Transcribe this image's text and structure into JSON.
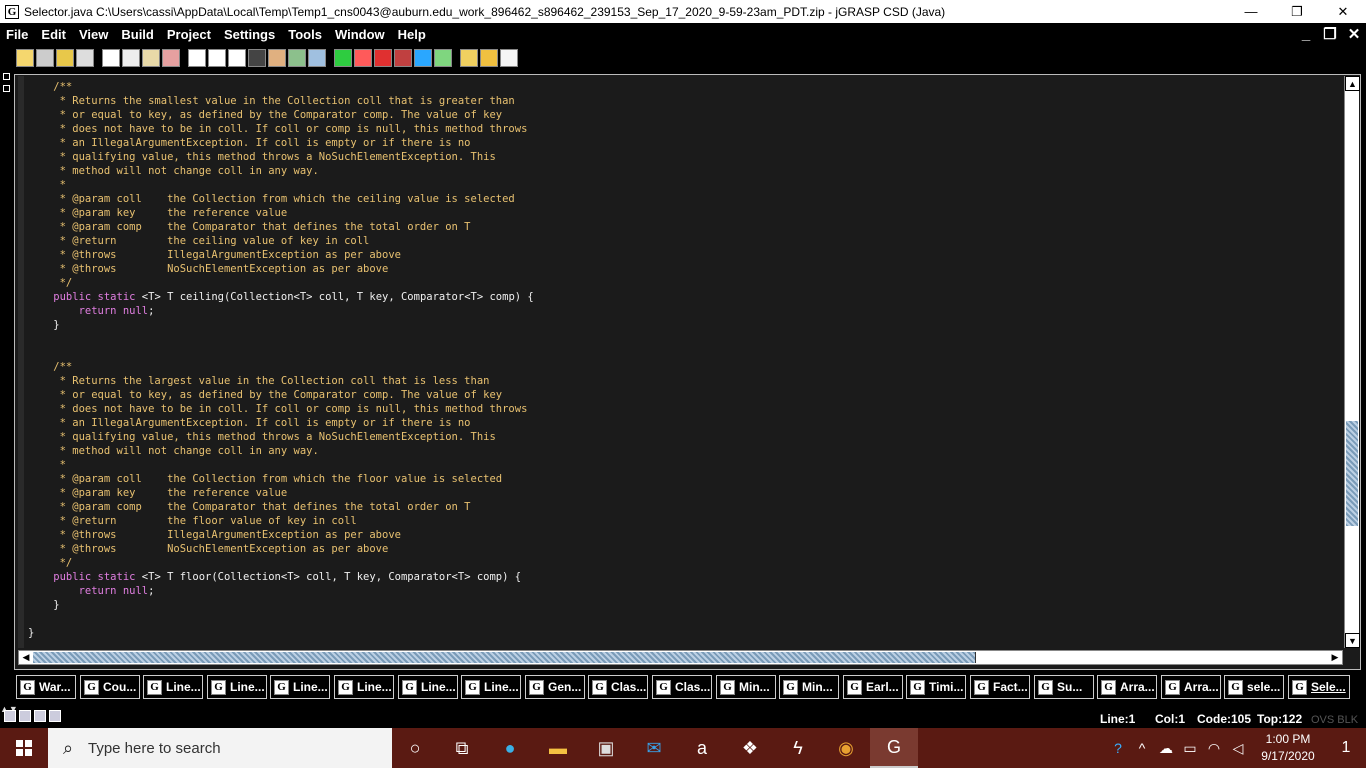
{
  "window": {
    "icon": "G",
    "title": "Selector.java  C:\\Users\\cassi\\AppData\\Local\\Temp\\Temp1_cns0043@auburn.edu_work_896462_s896462_239153_Sep_17_2020_9-59-23am_PDT.zip - jGRASP CSD (Java)",
    "minimize": "—",
    "restore": "❐",
    "close": "✕"
  },
  "menu": [
    "File",
    "Edit",
    "View",
    "Build",
    "Project",
    "Settings",
    "Tools",
    "Window",
    "Help"
  ],
  "mdi": {
    "minimize": "_",
    "restore": "❐",
    "close": "✕"
  },
  "code_lines": [
    [
      [
        "c-comment",
        "    /**"
      ]
    ],
    [
      [
        "c-comment",
        "     * Returns the smallest value in the Collection coll that is greater than"
      ]
    ],
    [
      [
        "c-comment",
        "     * or equal to key, as defined by the Comparator comp. The value of key"
      ]
    ],
    [
      [
        "c-comment",
        "     * does not have to be in coll. If coll or comp is null, this method throws"
      ]
    ],
    [
      [
        "c-comment",
        "     * an IllegalArgumentException. If coll is empty or if there is no"
      ]
    ],
    [
      [
        "c-comment",
        "     * qualifying value, this method throws a NoSuchElementException. This"
      ]
    ],
    [
      [
        "c-comment",
        "     * method will not change coll in any way."
      ]
    ],
    [
      [
        "c-comment",
        "     *"
      ]
    ],
    [
      [
        "c-comment",
        "     * @param coll    the Collection from which the ceiling value is selected"
      ]
    ],
    [
      [
        "c-comment",
        "     * @param key     the reference value"
      ]
    ],
    [
      [
        "c-comment",
        "     * @param comp    the Comparator that defines the total order on T"
      ]
    ],
    [
      [
        "c-comment",
        "     * @return        the ceiling value of key in coll"
      ]
    ],
    [
      [
        "c-comment",
        "     * @throws        IllegalArgumentException as per above"
      ]
    ],
    [
      [
        "c-comment",
        "     * @throws        NoSuchElementException as per above"
      ]
    ],
    [
      [
        "c-comment",
        "     */"
      ]
    ],
    [
      [
        "c-kw",
        "    public static "
      ],
      [
        "c-txt",
        "<T> T ceiling(Collection<T> coll, T key, Comparator<T> comp) {"
      ]
    ],
    [
      [
        "c-kw",
        "        return null"
      ],
      [
        "c-txt",
        ";"
      ]
    ],
    [
      [
        "c-txt",
        "    }"
      ]
    ],
    [
      [
        "c-txt",
        ""
      ]
    ],
    [
      [
        "c-txt",
        ""
      ]
    ],
    [
      [
        "c-comment",
        "    /**"
      ]
    ],
    [
      [
        "c-comment",
        "     * Returns the largest value in the Collection coll that is less than"
      ]
    ],
    [
      [
        "c-comment",
        "     * or equal to key, as defined by the Comparator comp. The value of key"
      ]
    ],
    [
      [
        "c-comment",
        "     * does not have to be in coll. If coll or comp is null, this method throws"
      ]
    ],
    [
      [
        "c-comment",
        "     * an IllegalArgumentException. If coll is empty or if there is no"
      ]
    ],
    [
      [
        "c-comment",
        "     * qualifying value, this method throws a NoSuchElementException. This"
      ]
    ],
    [
      [
        "c-comment",
        "     * method will not change coll in any way."
      ]
    ],
    [
      [
        "c-comment",
        "     *"
      ]
    ],
    [
      [
        "c-comment",
        "     * @param coll    the Collection from which the floor value is selected"
      ]
    ],
    [
      [
        "c-comment",
        "     * @param key     the reference value"
      ]
    ],
    [
      [
        "c-comment",
        "     * @param comp    the Comparator that defines the total order on T"
      ]
    ],
    [
      [
        "c-comment",
        "     * @return        the floor value of key in coll"
      ]
    ],
    [
      [
        "c-comment",
        "     * @throws        IllegalArgumentException as per above"
      ]
    ],
    [
      [
        "c-comment",
        "     * @throws        NoSuchElementException as per above"
      ]
    ],
    [
      [
        "c-comment",
        "     */"
      ]
    ],
    [
      [
        "c-kw",
        "    public static "
      ],
      [
        "c-txt",
        "<T> T floor(Collection<T> coll, T key, Comparator<T> comp) {"
      ]
    ],
    [
      [
        "c-kw",
        "        return null"
      ],
      [
        "c-txt",
        ";"
      ]
    ],
    [
      [
        "c-txt",
        "    }"
      ]
    ],
    [
      [
        "c-txt",
        ""
      ]
    ],
    [
      [
        "c-txt",
        "}"
      ]
    ]
  ],
  "window_tabs": [
    "War...",
    "Cou...",
    "Line...",
    "Line...",
    "Line...",
    "Line...",
    "Line...",
    "Line...",
    "Gen...",
    "Clas...",
    "Clas...",
    "Min...",
    "Min...",
    "Earl...",
    "Timi...",
    "Fact...",
    "Su...",
    "Arra...",
    "Arra...",
    "sele...",
    "Sele..."
  ],
  "active_tab_index": 20,
  "status": {
    "line": "Line:1",
    "col": "Col:1",
    "code": "Code:105",
    "top": "Top:122",
    "mode": "OVS BLK"
  },
  "taskbar": {
    "search_placeholder": "Type here to search",
    "time": "1:00 PM",
    "date": "9/17/2020",
    "notification_count": "1"
  }
}
